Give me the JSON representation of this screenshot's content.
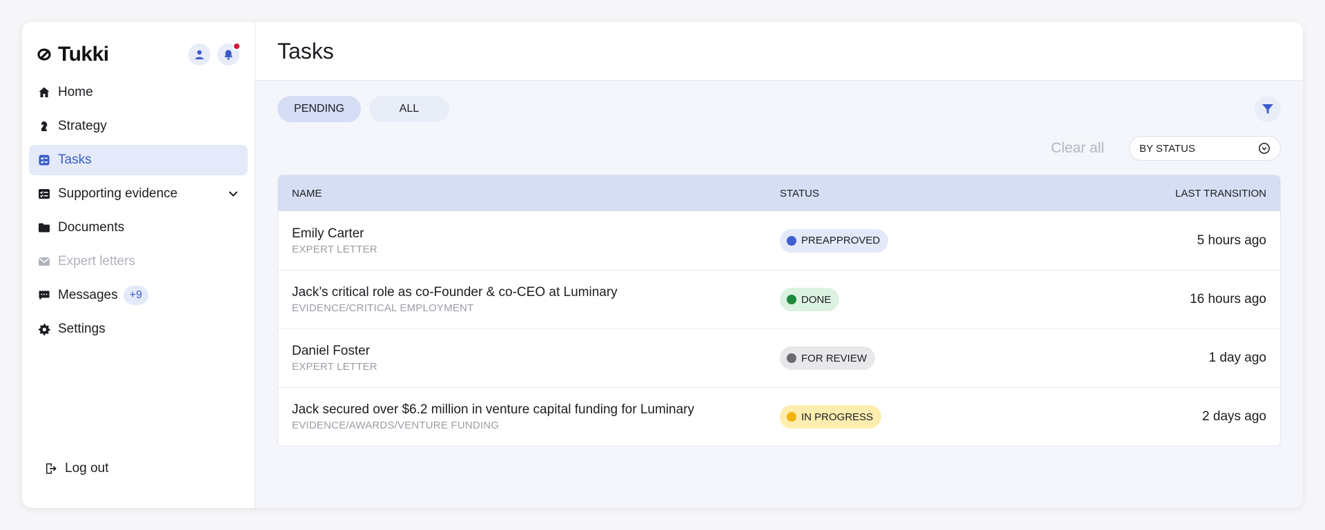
{
  "brand": {
    "name": "Tukki"
  },
  "sidebar": {
    "items": [
      {
        "label": "Home",
        "icon": "home-icon"
      },
      {
        "label": "Strategy",
        "icon": "chess-knight-icon"
      },
      {
        "label": "Tasks",
        "icon": "tasks-icon",
        "active": true
      },
      {
        "label": "Supporting evidence",
        "icon": "checklist-icon",
        "expandable": true
      },
      {
        "label": "Documents",
        "icon": "folder-icon"
      },
      {
        "label": "Expert letters",
        "icon": "envelope-icon",
        "disabled": true
      },
      {
        "label": "Messages",
        "icon": "chat-icon",
        "badge": "+9"
      },
      {
        "label": "Settings",
        "icon": "gear-icon"
      }
    ],
    "logout_label": "Log out"
  },
  "main": {
    "title": "Tasks",
    "tabs": [
      {
        "label": "PENDING",
        "active": true
      },
      {
        "label": "ALL",
        "active": false
      }
    ],
    "clear_all": "Clear all",
    "sort_select": {
      "value": "BY STATUS"
    },
    "table": {
      "headers": {
        "name": "NAME",
        "status": "STATUS",
        "last": "LAST TRANSITION"
      },
      "rows": [
        {
          "title": "Emily Carter",
          "sub": "EXPERT LETTER",
          "status": "PREAPPROVED",
          "status_bg": "#e3e9f8",
          "status_dot": "#3f5fd0",
          "last": "5 hours ago"
        },
        {
          "title": "Jack’s critical role as co-Founder & co-CEO at Luminary",
          "sub": "EVIDENCE/CRITICAL EMPLOYMENT",
          "status": "DONE",
          "status_bg": "#dcf2e1",
          "status_dot": "#1e8a3a",
          "last": "16 hours ago"
        },
        {
          "title": "Daniel Foster",
          "sub": "EXPERT LETTER",
          "status": "FOR REVIEW",
          "status_bg": "#e8e8ea",
          "status_dot": "#6b6b70",
          "last": "1 day ago"
        },
        {
          "title": "Jack secured over $6.2 million in venture capital funding for Luminary",
          "sub": "EVIDENCE/AWARDS/VENTURE FUNDING",
          "status": "IN PROGRESS",
          "status_bg": "#fdeeb0",
          "status_dot": "#f2b30b",
          "last": "2 days ago"
        }
      ]
    }
  },
  "colors": {
    "accent": "#3a5cc9",
    "notification": "#d6183a"
  }
}
